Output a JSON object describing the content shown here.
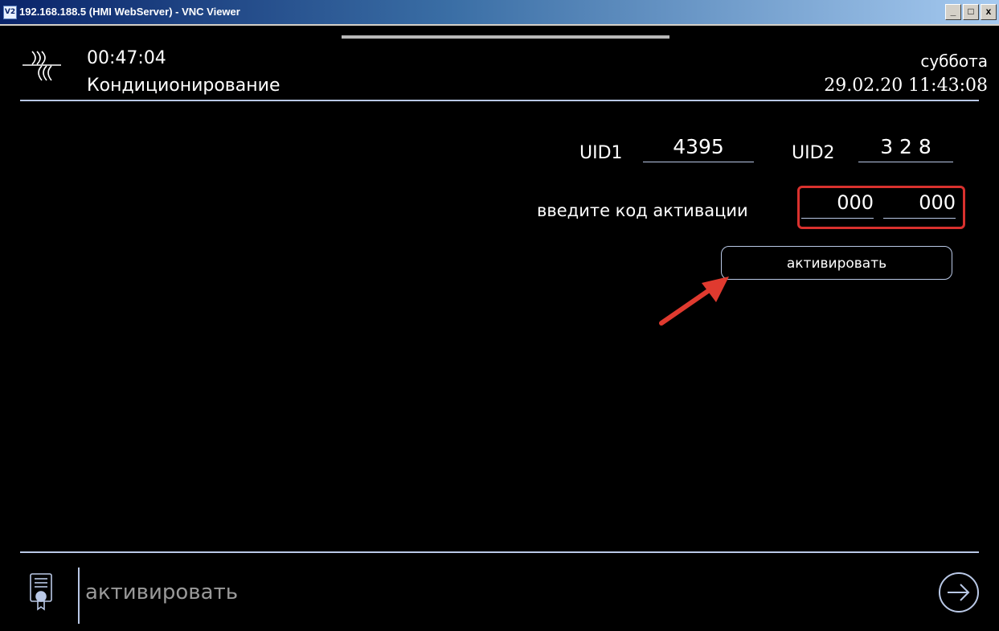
{
  "window": {
    "icon_label": "V2",
    "title": "192.168.188.5 (HMI WebServer) - VNC Viewer",
    "minimize_label": "_",
    "maximize_label": "□",
    "close_label": "x"
  },
  "header": {
    "elapsed_time": "00:47:04",
    "page_title": "Кондиционирование",
    "weekday": "суббота",
    "datetime": "29.02.20 11:43:08",
    "logo_icon": "heating-coil-icon"
  },
  "main": {
    "uid1_label": "UID1",
    "uid1_value": "4395",
    "uid2_label": "UID2",
    "uid2_value": "3 2 8",
    "code_prompt": "введите код активации",
    "code_part1": "000",
    "code_part2": "000",
    "activate_button_label": "активировать",
    "highlight_color": "#d9312e"
  },
  "footer": {
    "icon": "certificate-icon",
    "label": "активировать",
    "next_icon": "arrow-right-circle-icon"
  }
}
